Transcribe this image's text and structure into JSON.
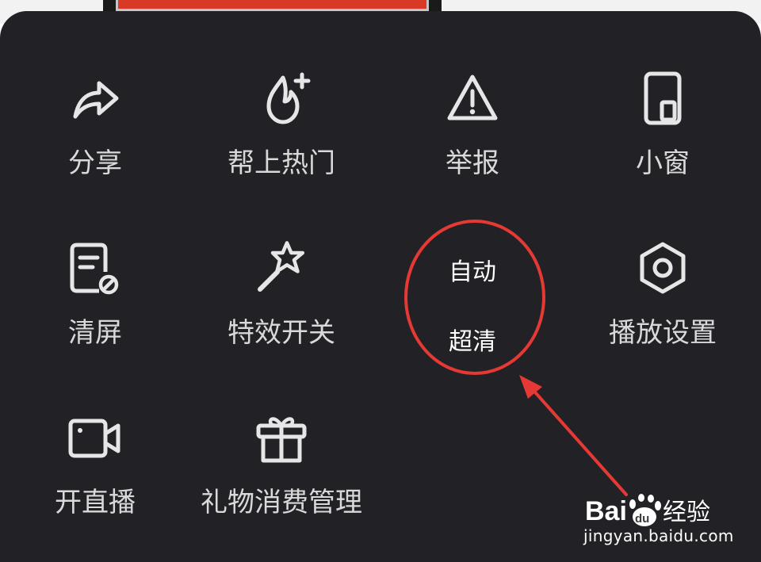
{
  "menu": {
    "items": [
      {
        "label": "分享",
        "icon": "share-icon"
      },
      {
        "label": "帮上热门",
        "icon": "flame-plus-icon"
      },
      {
        "label": "举报",
        "icon": "warning-icon"
      },
      {
        "label": "小窗",
        "icon": "mini-window-icon"
      },
      {
        "label": "清屏",
        "icon": "clear-screen-icon"
      },
      {
        "label": "特效开关",
        "icon": "magic-wand-icon"
      },
      {
        "label": "自动",
        "sublabel": "超清",
        "icon": "none"
      },
      {
        "label": "播放设置",
        "icon": "hexagon-settings-icon"
      },
      {
        "label": "开直播",
        "icon": "video-camera-icon"
      },
      {
        "label": "礼物消费管理",
        "icon": "gift-icon"
      }
    ]
  },
  "watermark": {
    "brand_text": "Baidu经验",
    "url": "jingyan.baidu.com"
  },
  "colors": {
    "panel_bg": "#222226",
    "text": "#d9d9d9",
    "annotation_red": "#e53935"
  }
}
